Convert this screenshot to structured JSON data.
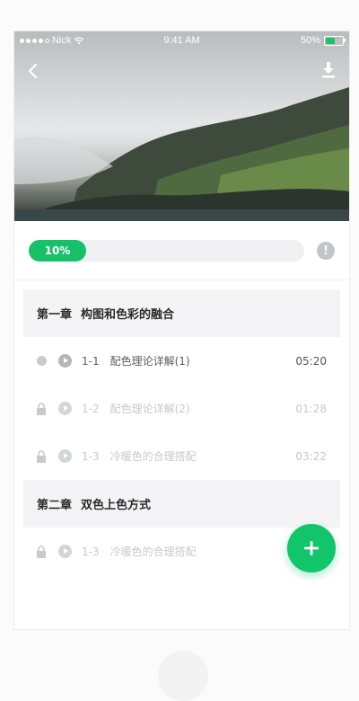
{
  "status_bar": {
    "carrier": "Nick",
    "time": "9:41 AM",
    "battery": "50%"
  },
  "header": {
    "back_icon": "chevron-left-icon",
    "download_icon": "download-icon"
  },
  "progress": {
    "percent": 10,
    "label": "10%",
    "info_icon_glyph": "!",
    "accent": "#18c06a"
  },
  "chapters": [
    {
      "number": "第一章",
      "title": "构图和色彩的融合",
      "lessons": [
        {
          "code": "1-1",
          "title": "配色理论详解(1)",
          "duration": "05:20",
          "state": "in-progress"
        },
        {
          "code": "1-2",
          "title": "配色理论详解(2)",
          "duration": "01:28",
          "state": "locked"
        },
        {
          "code": "1-3",
          "title": "冷暖色的合理搭配",
          "duration": "03:22",
          "state": "locked"
        }
      ]
    },
    {
      "number": "第二章",
      "title": "双色上色方式",
      "lessons": [
        {
          "code": "1-3",
          "title": "冷暖色的合理搭配",
          "duration": "",
          "state": "locked"
        }
      ]
    }
  ],
  "fab": {
    "label": "+",
    "color": "#12c46a"
  }
}
